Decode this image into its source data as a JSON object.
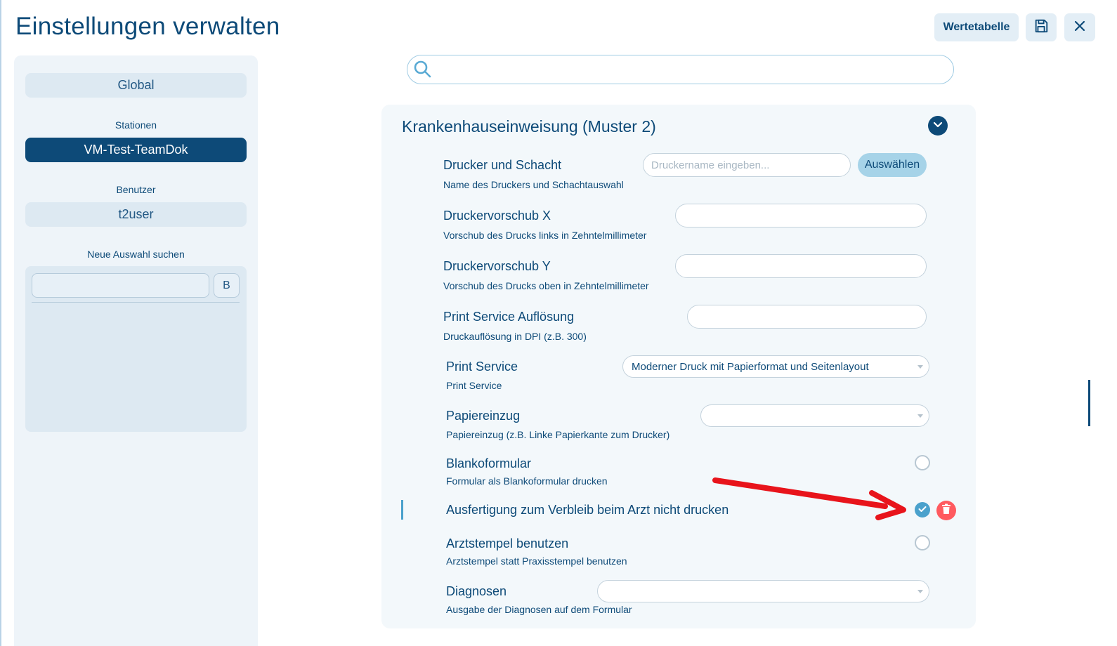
{
  "page": {
    "title": "Einstellungen verwalten"
  },
  "toolbar": {
    "wertetabelle_label": "Wertetabelle",
    "save_icon": "save-icon",
    "close_icon": "close-icon"
  },
  "sidebar": {
    "global_label": "Global",
    "stationen_heading": "Stationen",
    "station_selected": "VM-Test-TeamDok",
    "benutzer_heading": "Benutzer",
    "benutzer_value": "t2user",
    "neue_auswahl_heading": "Neue Auswahl suchen",
    "search_value": "",
    "search_button_label": "B"
  },
  "search": {
    "value": "",
    "icon": "search-icon"
  },
  "section": {
    "title": "Krankenhauseinweisung (Muster 2)",
    "expanded": true,
    "settings": {
      "drucker": {
        "title": "Drucker und Schacht",
        "description": "Name des Druckers und Schachtauswahl",
        "placeholder": "Druckername eingeben...",
        "value": "",
        "button_label": "Auswählen"
      },
      "vorschub_x": {
        "title": "Druckervorschub X",
        "description": "Vorschub des Drucks links in Zehntelmillimeter",
        "value": ""
      },
      "vorschub_y": {
        "title": "Druckervorschub Y",
        "description": "Vorschub des Drucks oben in Zehntelmillimeter",
        "value": ""
      },
      "aufloesung": {
        "title": "Print Service Auflösung",
        "description": "Druckauflösung in DPI (z.B. 300)",
        "value": ""
      },
      "print_service": {
        "title": "Print Service",
        "description": "Print Service",
        "selected": "Moderner Druck mit Papierformat und Seitenlayout"
      },
      "papiereinzug": {
        "title": "Papiereinzug",
        "description": "Papiereinzug (z.B. Linke Papierkante zum Drucker)",
        "selected": ""
      },
      "blankoformular": {
        "title": "Blankoformular",
        "description": "Formular als Blankoformular drucken",
        "checked": false
      },
      "ausfertigung": {
        "title": "Ausfertigung zum Verbleib beim Arzt nicht drucken",
        "checked": true,
        "delete_icon": "trash-icon"
      },
      "arztstempel": {
        "title": "Arztstempel benutzen",
        "description": "Arztstempel statt Praxisstempel benutzen",
        "checked": false
      },
      "diagnosen": {
        "title": "Diagnosen",
        "description": "Ausgabe der Diagnosen auf dem Formular",
        "selected": ""
      }
    }
  },
  "colors": {
    "primary": "#0d4a78",
    "accent": "#4aa1cc",
    "danger": "#ff5a5f",
    "annotation_arrow": "#e8141b"
  }
}
